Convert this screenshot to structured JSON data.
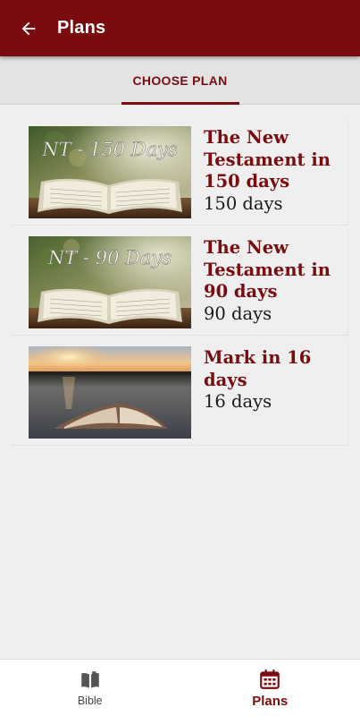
{
  "header": {
    "title": "Plans"
  },
  "tabs": [
    {
      "label": "CHOOSE PLAN",
      "selected": true
    }
  ],
  "plans": [
    {
      "title": "The New Testament in 150 days",
      "duration": "150 days",
      "thumbnail_text": "NT - 150 Days"
    },
    {
      "title": "The New Testament in 90 days",
      "duration": "90 days",
      "thumbnail_text": "NT - 90 Days"
    },
    {
      "title": "Mark in 16 days",
      "duration": "16 days"
    }
  ],
  "bottom_nav": [
    {
      "label": "Bible",
      "icon": "book-icon",
      "active": false
    },
    {
      "label": "Plans",
      "icon": "calendar-icon",
      "active": true
    }
  ],
  "colors": {
    "primary": "#7a0c10",
    "background": "#efefef"
  }
}
